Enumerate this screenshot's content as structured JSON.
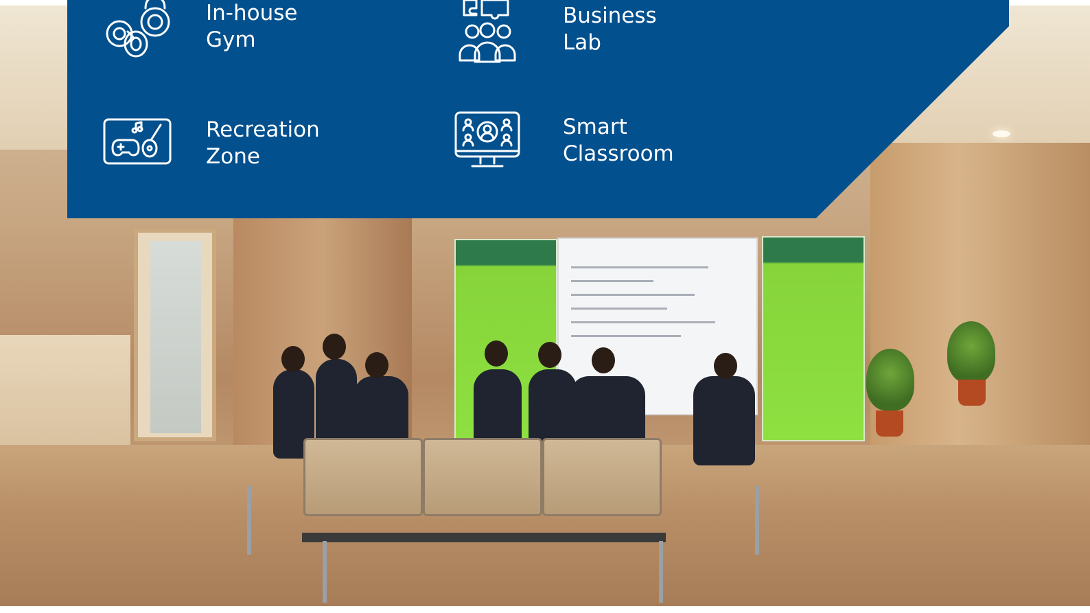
{
  "panel": {
    "background_color": "#02508e",
    "features": [
      {
        "id": "gym",
        "icon": "kettlebell-dumbbell-icon",
        "line1": "In-house",
        "line2": "Gym"
      },
      {
        "id": "business-lab",
        "icon": "team-puzzle-icon",
        "line1": "Business",
        "line2": "Lab"
      },
      {
        "id": "recreation",
        "icon": "gamepad-guitar-icon",
        "line1": "Recreation",
        "line2": "Zone"
      },
      {
        "id": "smart-classroom",
        "icon": "monitor-video-conference-icon",
        "line1": "Smart",
        "line2": "Classroom"
      }
    ]
  },
  "photo": {
    "description_icon": "campus-lobby-photo"
  }
}
